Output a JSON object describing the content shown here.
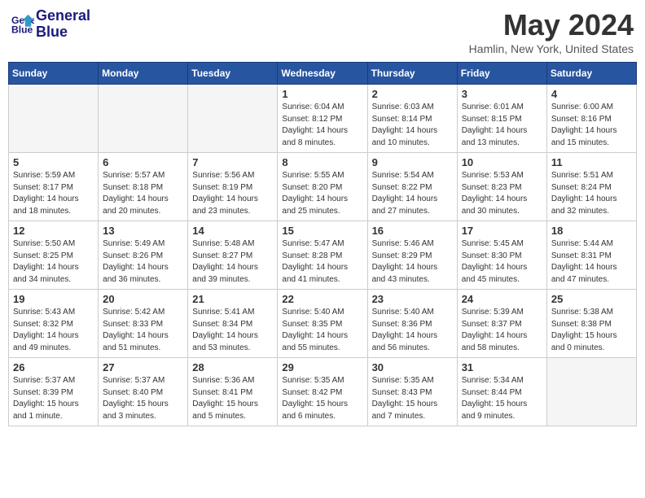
{
  "logo": {
    "line1": "General",
    "line2": "Blue"
  },
  "title": "May 2024",
  "location": "Hamlin, New York, United States",
  "days_of_week": [
    "Sunday",
    "Monday",
    "Tuesday",
    "Wednesday",
    "Thursday",
    "Friday",
    "Saturday"
  ],
  "weeks": [
    [
      {
        "day": "",
        "info": ""
      },
      {
        "day": "",
        "info": ""
      },
      {
        "day": "",
        "info": ""
      },
      {
        "day": "1",
        "info": "Sunrise: 6:04 AM\nSunset: 8:12 PM\nDaylight: 14 hours\nand 8 minutes."
      },
      {
        "day": "2",
        "info": "Sunrise: 6:03 AM\nSunset: 8:14 PM\nDaylight: 14 hours\nand 10 minutes."
      },
      {
        "day": "3",
        "info": "Sunrise: 6:01 AM\nSunset: 8:15 PM\nDaylight: 14 hours\nand 13 minutes."
      },
      {
        "day": "4",
        "info": "Sunrise: 6:00 AM\nSunset: 8:16 PM\nDaylight: 14 hours\nand 15 minutes."
      }
    ],
    [
      {
        "day": "5",
        "info": "Sunrise: 5:59 AM\nSunset: 8:17 PM\nDaylight: 14 hours\nand 18 minutes."
      },
      {
        "day": "6",
        "info": "Sunrise: 5:57 AM\nSunset: 8:18 PM\nDaylight: 14 hours\nand 20 minutes."
      },
      {
        "day": "7",
        "info": "Sunrise: 5:56 AM\nSunset: 8:19 PM\nDaylight: 14 hours\nand 23 minutes."
      },
      {
        "day": "8",
        "info": "Sunrise: 5:55 AM\nSunset: 8:20 PM\nDaylight: 14 hours\nand 25 minutes."
      },
      {
        "day": "9",
        "info": "Sunrise: 5:54 AM\nSunset: 8:22 PM\nDaylight: 14 hours\nand 27 minutes."
      },
      {
        "day": "10",
        "info": "Sunrise: 5:53 AM\nSunset: 8:23 PM\nDaylight: 14 hours\nand 30 minutes."
      },
      {
        "day": "11",
        "info": "Sunrise: 5:51 AM\nSunset: 8:24 PM\nDaylight: 14 hours\nand 32 minutes."
      }
    ],
    [
      {
        "day": "12",
        "info": "Sunrise: 5:50 AM\nSunset: 8:25 PM\nDaylight: 14 hours\nand 34 minutes."
      },
      {
        "day": "13",
        "info": "Sunrise: 5:49 AM\nSunset: 8:26 PM\nDaylight: 14 hours\nand 36 minutes."
      },
      {
        "day": "14",
        "info": "Sunrise: 5:48 AM\nSunset: 8:27 PM\nDaylight: 14 hours\nand 39 minutes."
      },
      {
        "day": "15",
        "info": "Sunrise: 5:47 AM\nSunset: 8:28 PM\nDaylight: 14 hours\nand 41 minutes."
      },
      {
        "day": "16",
        "info": "Sunrise: 5:46 AM\nSunset: 8:29 PM\nDaylight: 14 hours\nand 43 minutes."
      },
      {
        "day": "17",
        "info": "Sunrise: 5:45 AM\nSunset: 8:30 PM\nDaylight: 14 hours\nand 45 minutes."
      },
      {
        "day": "18",
        "info": "Sunrise: 5:44 AM\nSunset: 8:31 PM\nDaylight: 14 hours\nand 47 minutes."
      }
    ],
    [
      {
        "day": "19",
        "info": "Sunrise: 5:43 AM\nSunset: 8:32 PM\nDaylight: 14 hours\nand 49 minutes."
      },
      {
        "day": "20",
        "info": "Sunrise: 5:42 AM\nSunset: 8:33 PM\nDaylight: 14 hours\nand 51 minutes."
      },
      {
        "day": "21",
        "info": "Sunrise: 5:41 AM\nSunset: 8:34 PM\nDaylight: 14 hours\nand 53 minutes."
      },
      {
        "day": "22",
        "info": "Sunrise: 5:40 AM\nSunset: 8:35 PM\nDaylight: 14 hours\nand 55 minutes."
      },
      {
        "day": "23",
        "info": "Sunrise: 5:40 AM\nSunset: 8:36 PM\nDaylight: 14 hours\nand 56 minutes."
      },
      {
        "day": "24",
        "info": "Sunrise: 5:39 AM\nSunset: 8:37 PM\nDaylight: 14 hours\nand 58 minutes."
      },
      {
        "day": "25",
        "info": "Sunrise: 5:38 AM\nSunset: 8:38 PM\nDaylight: 15 hours\nand 0 minutes."
      }
    ],
    [
      {
        "day": "26",
        "info": "Sunrise: 5:37 AM\nSunset: 8:39 PM\nDaylight: 15 hours\nand 1 minute."
      },
      {
        "day": "27",
        "info": "Sunrise: 5:37 AM\nSunset: 8:40 PM\nDaylight: 15 hours\nand 3 minutes."
      },
      {
        "day": "28",
        "info": "Sunrise: 5:36 AM\nSunset: 8:41 PM\nDaylight: 15 hours\nand 5 minutes."
      },
      {
        "day": "29",
        "info": "Sunrise: 5:35 AM\nSunset: 8:42 PM\nDaylight: 15 hours\nand 6 minutes."
      },
      {
        "day": "30",
        "info": "Sunrise: 5:35 AM\nSunset: 8:43 PM\nDaylight: 15 hours\nand 7 minutes."
      },
      {
        "day": "31",
        "info": "Sunrise: 5:34 AM\nSunset: 8:44 PM\nDaylight: 15 hours\nand 9 minutes."
      },
      {
        "day": "",
        "info": ""
      }
    ]
  ]
}
